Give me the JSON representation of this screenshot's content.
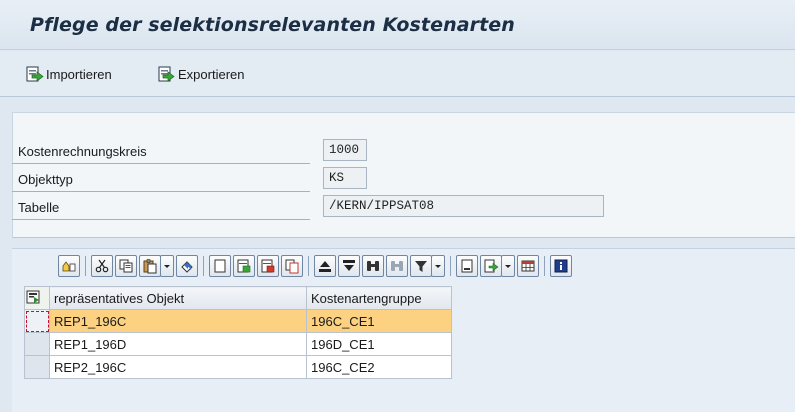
{
  "title": "Pflege der selektionsrelevanten Kostenarten",
  "toolbar": {
    "import_label": "Importieren",
    "export_label": "Exportieren"
  },
  "form": {
    "fields": [
      {
        "label": "Kostenrechnungskreis",
        "value": "1000"
      },
      {
        "label": "Objekttyp",
        "value": "KS"
      },
      {
        "label": "Tabelle",
        "value": "/KERN/IPPSAT08"
      }
    ]
  },
  "grid": {
    "columns": [
      "repräsentatives Objekt",
      "Kostenartengruppe"
    ],
    "rows": [
      [
        "REP1_196C",
        "196C_CE1"
      ],
      [
        "REP1_196D",
        "196D_CE1"
      ],
      [
        "REP2_196C",
        "196C_CE2"
      ]
    ],
    "selected_row": 0,
    "highlight_color": "#fcd181"
  },
  "icons": {
    "grid_toolbar": [
      "details-icon",
      "cut-icon",
      "copy-icon",
      "paste-icon",
      "undo-icon",
      "new-row-icon",
      "insert-row-icon",
      "delete-row-icon",
      "duplicate-row-icon",
      "sort-ascending-icon",
      "sort-descending-icon",
      "find-icon",
      "find-next-icon",
      "filter-icon",
      "print-icon",
      "export-icon",
      "layout-icon",
      "info-icon"
    ]
  }
}
